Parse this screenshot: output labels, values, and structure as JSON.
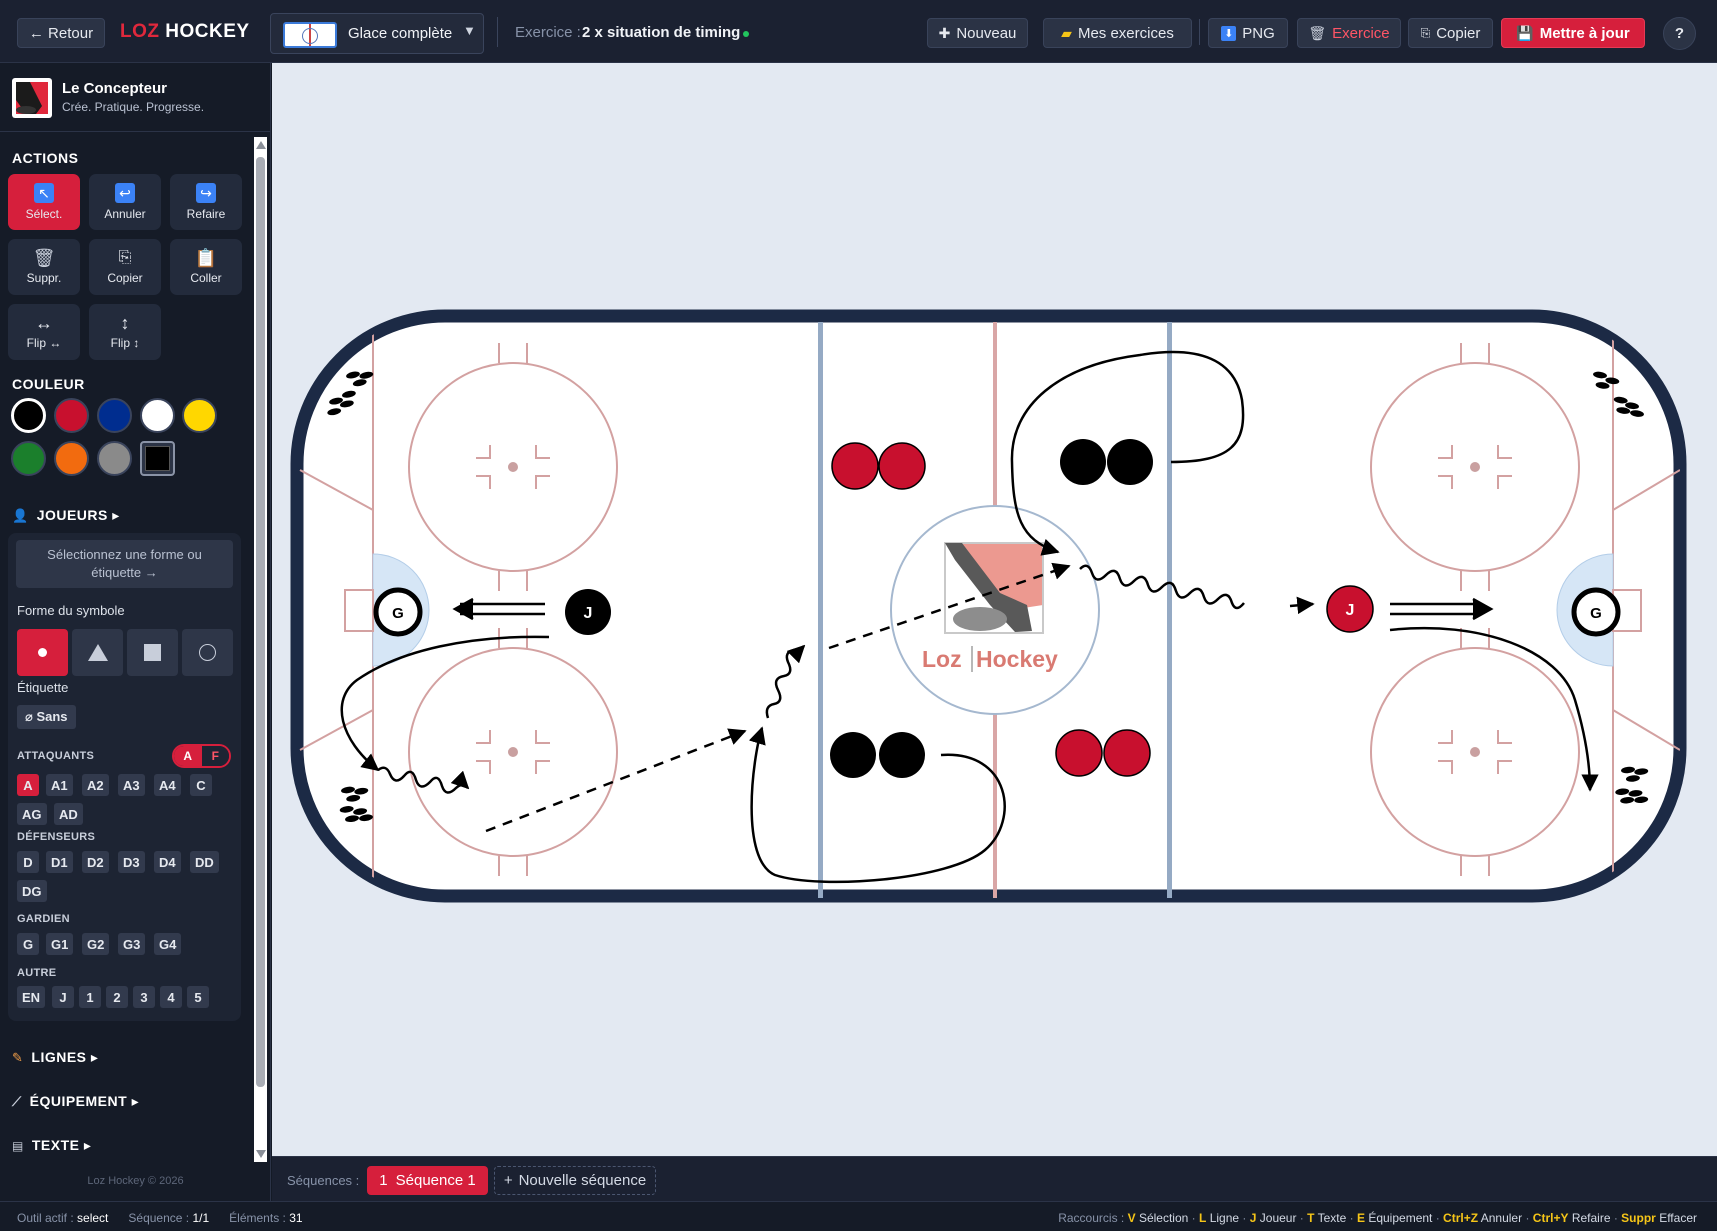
{
  "topbar": {
    "back_label": "← Retour",
    "brand_part1": "LOZ",
    "brand_part2": "HOCKEY",
    "view_select": "Glace complète",
    "exercise_label": "Exercice :",
    "exercise_name": "2 x situation de timing",
    "new_label": "Nouveau",
    "my_exercises_label": "Mes exercices",
    "png_label": "PNG",
    "exercise_btn_label": "Exercice",
    "copy_label": "Copier",
    "update_label": "Mettre à jour",
    "help_label": "?"
  },
  "sidebar": {
    "app_name": "Le Concepteur",
    "tagline": "Crée. Pratique. Progresse.",
    "actions_title": "ACTIONS",
    "actions": [
      {
        "label": "Sélect.",
        "icon": "select-arrow-icon"
      },
      {
        "label": "Annuler",
        "icon": "undo-icon"
      },
      {
        "label": "Refaire",
        "icon": "redo-icon"
      },
      {
        "label": "Suppr.",
        "icon": "trash-icon"
      },
      {
        "label": "Copier",
        "icon": "copy-icon"
      },
      {
        "label": "Coller",
        "icon": "paste-icon"
      },
      {
        "label": "Flip ↔",
        "icon": "flip-horizontal-icon"
      },
      {
        "label": "Flip ↕",
        "icon": "flip-vertical-icon"
      }
    ],
    "color_title": "COULEUR",
    "colors": [
      "#000000",
      "#c8102e",
      "#002d8f",
      "#ffffff",
      "#ffd700",
      "#1b7f2c",
      "#f26b0f",
      "#8a8a8a",
      "#000000"
    ],
    "players_title": "JOUEURS ▸",
    "hint": "Sélectionnez une forme ou étiquette →",
    "shape_label": "Forme du symbole",
    "label_label": "Étiquette",
    "none_label": "⌀ Sans",
    "attackers_title": "ATTAQUANTS",
    "toggle_a": "A",
    "toggle_f": "F",
    "attackers": [
      "A",
      "A1",
      "A2",
      "A3",
      "A4",
      "C",
      "AG",
      "AD"
    ],
    "defenders_title": "DÉFENSEURS",
    "defenders": [
      "D",
      "D1",
      "D2",
      "D3",
      "D4",
      "DD",
      "DG"
    ],
    "goalie_title": "GARDIEN",
    "goalies": [
      "G",
      "G1",
      "G2",
      "G3",
      "G4"
    ],
    "other_title": "AUTRE",
    "others": [
      "EN",
      "J",
      "1",
      "2",
      "3",
      "4",
      "5"
    ],
    "lines_title": "LIGNES ▸",
    "equipment_title": "ÉQUIPEMENT ▸",
    "text_title": "TEXTE ▸",
    "copyright": "Loz Hockey © 2026"
  },
  "rink": {
    "logo_text_left": "Loz",
    "logo_text_right": "Hockey",
    "goalie_label": "G",
    "player_label": "J"
  },
  "sequences": {
    "label": "Séquences :",
    "active_num": "1",
    "active_label": "Séquence 1",
    "new_label": "Nouvelle séquence"
  },
  "status": {
    "tool_label": "Outil actif :",
    "tool_value": "select",
    "seq_label": "Séquence :",
    "seq_value": "1/1",
    "elements_label": "Éléments :",
    "elements_value": "31",
    "shortcuts_label": "Raccourcis :",
    "shortcuts": [
      {
        "key": "V",
        "action": "Sélection"
      },
      {
        "key": "L",
        "action": "Ligne"
      },
      {
        "key": "J",
        "action": "Joueur"
      },
      {
        "key": "T",
        "action": "Texte"
      },
      {
        "key": "E",
        "action": "Équipement"
      },
      {
        "key": "Ctrl+Z",
        "action": "Annuler"
      },
      {
        "key": "Ctrl+Y",
        "action": "Refaire"
      },
      {
        "key": "Suppr",
        "action": "Effacer"
      }
    ]
  }
}
